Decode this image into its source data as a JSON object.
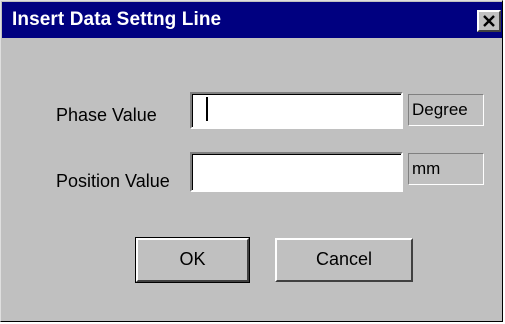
{
  "window": {
    "title": "Insert Data Settng Line",
    "close_symbol": "✕"
  },
  "fields": {
    "phase": {
      "label": "Phase Value",
      "value": "",
      "unit": "Degree"
    },
    "position": {
      "label": "Position Value",
      "value": "",
      "unit": "mm"
    }
  },
  "buttons": {
    "ok_label": "OK",
    "cancel_label": "Cancel"
  },
  "icons": {
    "close": "close-icon"
  }
}
